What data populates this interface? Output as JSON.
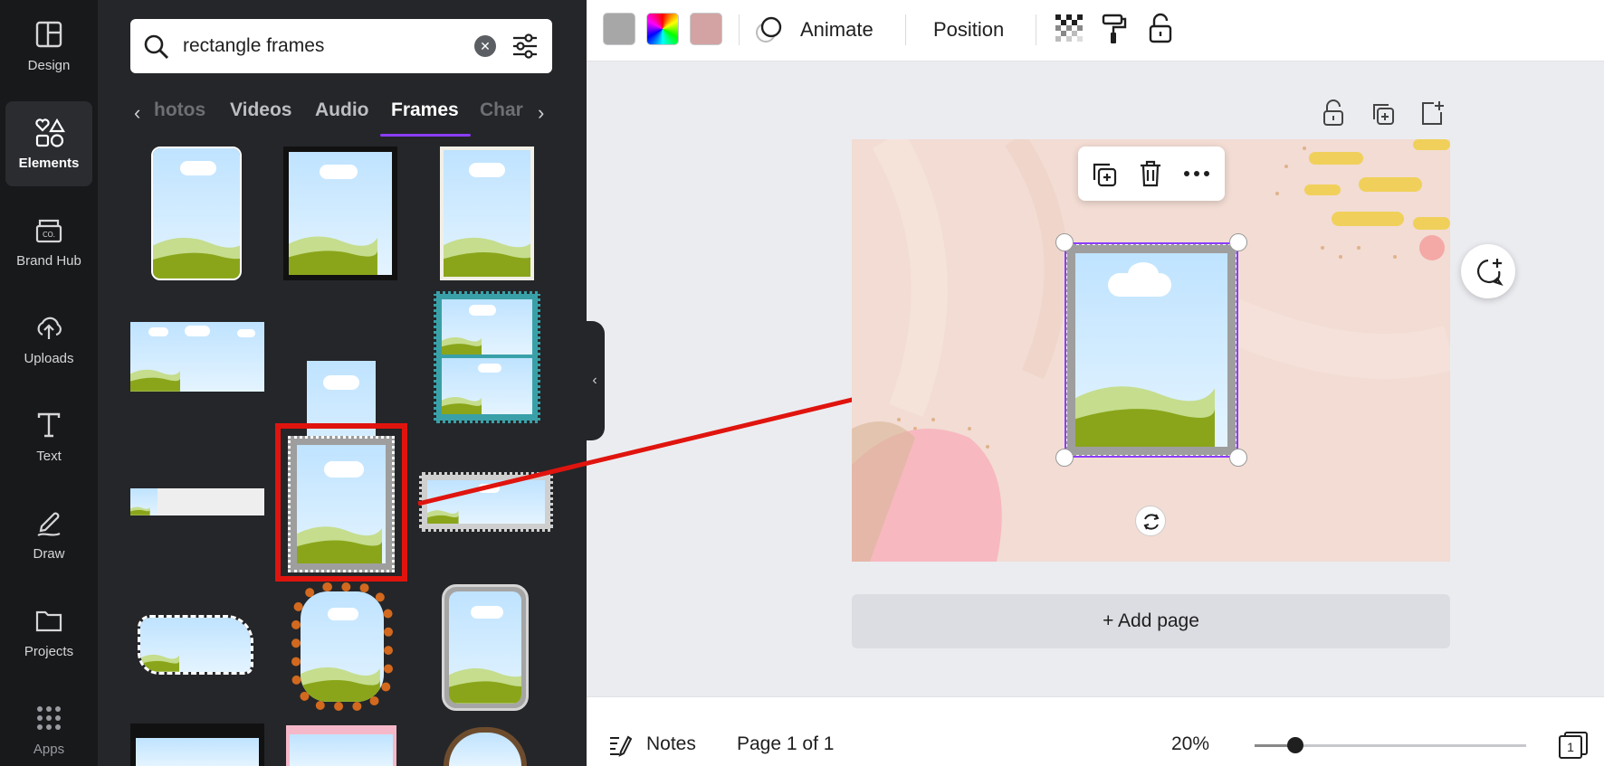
{
  "rail": {
    "items": [
      {
        "label": "Design",
        "icon": "design-icon"
      },
      {
        "label": "Elements",
        "icon": "elements-icon",
        "active": true
      },
      {
        "label": "Brand Hub",
        "icon": "brand-hub-icon"
      },
      {
        "label": "Uploads",
        "icon": "uploads-icon"
      },
      {
        "label": "Text",
        "icon": "text-icon"
      },
      {
        "label": "Draw",
        "icon": "draw-icon"
      },
      {
        "label": "Projects",
        "icon": "projects-icon"
      },
      {
        "label": "Apps",
        "icon": "apps-icon"
      }
    ]
  },
  "panel": {
    "search": {
      "value": "rectangle frames",
      "placeholder": ""
    },
    "tabs": [
      {
        "label": "hotos"
      },
      {
        "label": "Videos"
      },
      {
        "label": "Audio"
      },
      {
        "label": "Frames",
        "active": true
      },
      {
        "label": "Char"
      }
    ],
    "accent": "#8b3dff",
    "highlight": "#e0140e"
  },
  "toolbar": {
    "swatches": [
      "#a7a7a7",
      "rainbow",
      "#d3a3a3"
    ],
    "animate": "Animate",
    "position": "Position"
  },
  "canvas": {
    "add_page": "+ Add page",
    "page_bg": "#f2dcd3",
    "selection_color": "#8b3dff"
  },
  "bottom": {
    "notes": "Notes",
    "page_info": "Page 1 of 1",
    "zoom": "20%",
    "zoom_fraction": 0.15,
    "page_count": "1"
  }
}
